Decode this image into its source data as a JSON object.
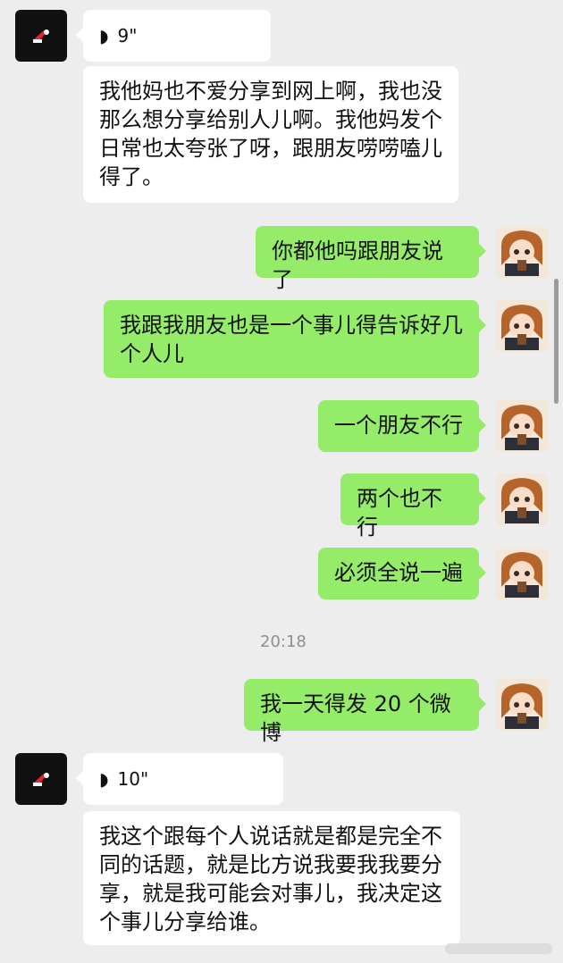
{
  "messages": [
    {
      "side": "left",
      "type": "voice",
      "duration": "9\""
    },
    {
      "side": "left",
      "type": "text",
      "text": "我他妈也不爱分享到网上啊，我也没那么想分享给别人儿啊。我他妈发个日常也太夸张了呀，跟朋友唠唠嗑儿得了。"
    },
    {
      "side": "right",
      "type": "text",
      "text": "你都他吗跟朋友说了"
    },
    {
      "side": "right",
      "type": "text",
      "text": "我跟我朋友也是一个事儿得告诉好几个人儿"
    },
    {
      "side": "right",
      "type": "text",
      "text": "一个朋友不行"
    },
    {
      "side": "right",
      "type": "text",
      "text": "两个也不行"
    },
    {
      "side": "right",
      "type": "text",
      "text": "必须全说一遍"
    },
    {
      "side": "center",
      "type": "time",
      "text": "20:18"
    },
    {
      "side": "right",
      "type": "text",
      "text": "我一天得发 20 个微博"
    },
    {
      "side": "left",
      "type": "voice",
      "duration": "10\""
    },
    {
      "side": "left",
      "type": "text",
      "text": "我这个跟每个人说话就是都是完全不同的话题，就是比方说我要我我要分享，就是我可能会对事儿，我决定这个事儿分享给谁。"
    }
  ],
  "colors": {
    "background": "#ededed",
    "incoming_bubble": "#ffffff",
    "outgoing_bubble": "#95ec69",
    "time_text": "#8f8f8f"
  },
  "icons": {
    "left_avatar": "black-square-avatar-with-red-santa-hat",
    "right_avatar": "anime-girl-avatar",
    "voice": "voice-wave-icon"
  }
}
